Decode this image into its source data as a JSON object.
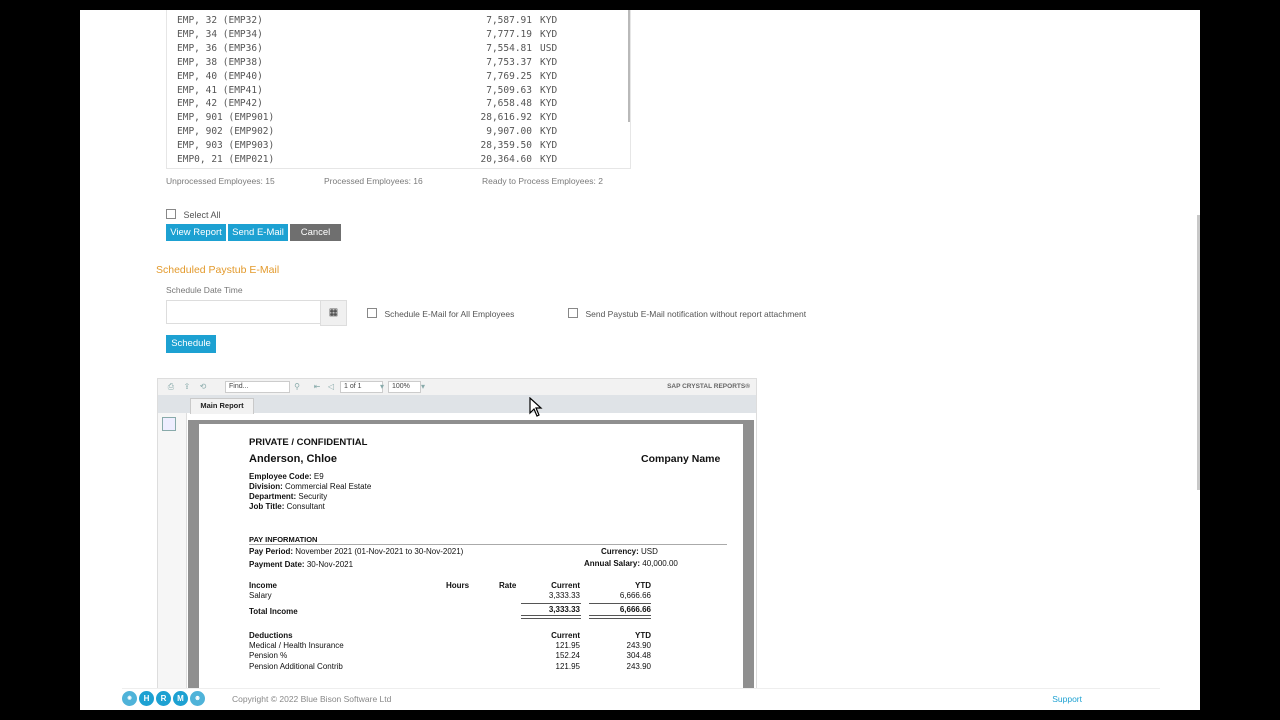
{
  "employees": [
    {
      "name": "EMP, 32 (EMP32)",
      "amount": "7,587.91",
      "currency": "KYD"
    },
    {
      "name": "EMP, 34 (EMP34)",
      "amount": "7,777.19",
      "currency": "KYD"
    },
    {
      "name": "EMP, 36 (EMP36)",
      "amount": "7,554.81",
      "currency": "USD"
    },
    {
      "name": "EMP, 38 (EMP38)",
      "amount": "7,753.37",
      "currency": "KYD"
    },
    {
      "name": "EMP, 40 (EMP40)",
      "amount": "7,769.25",
      "currency": "KYD"
    },
    {
      "name": "EMP, 41 (EMP41)",
      "amount": "7,509.63",
      "currency": "KYD"
    },
    {
      "name": "EMP, 42 (EMP42)",
      "amount": "7,658.48",
      "currency": "KYD"
    },
    {
      "name": "EMP, 901 (EMP901)",
      "amount": "28,616.92",
      "currency": "KYD"
    },
    {
      "name": "EMP, 902 (EMP902)",
      "amount": "9,907.00",
      "currency": "KYD"
    },
    {
      "name": "EMP, 903 (EMP903)",
      "amount": "28,359.50",
      "currency": "KYD"
    },
    {
      "name": "EMP0, 21 (EMP021)",
      "amount": "20,364.60",
      "currency": "KYD"
    }
  ],
  "counts": {
    "unprocessed": "Unprocessed Employees: 15",
    "processed": "Processed Employees: 16",
    "ready": "Ready to Process Employees: 2"
  },
  "select_all": "Select All",
  "buttons": {
    "view_report": "View Report",
    "send_email": "Send E-Mail",
    "cancel": "Cancel",
    "schedule": "Schedule"
  },
  "scheduled": {
    "title": "Scheduled Paystub E-Mail",
    "date_label": "Schedule Date Time",
    "date_value": "",
    "all_employees": "Schedule E-Mail for All Employees",
    "no_attachment": "Send Paystub E-Mail notification without report attachment"
  },
  "viewer": {
    "find_placeholder": "Find...",
    "page": "1 of 1",
    "zoom": "100%",
    "brand": "SAP CRYSTAL REPORTS®",
    "tab": "Main Report"
  },
  "report": {
    "confidential": "PRIVATE / CONFIDENTIAL",
    "employee_name": "Anderson, Chloe",
    "company": "Company Name",
    "employee_code_label": "Employee Code:",
    "employee_code": "E9",
    "division_label": "Division:",
    "division": "Commercial Real Estate",
    "department_label": "Department:",
    "department": "Security",
    "job_title_label": "Job Title:",
    "job_title": "Consultant",
    "pay_info": "PAY INFORMATION",
    "pay_period_label": "Pay Period:",
    "pay_period": "November 2021 (01-Nov-2021 to 30-Nov-2021)",
    "currency_label": "Currency:",
    "currency": "USD",
    "payment_date_label": "Payment Date:",
    "payment_date": "30-Nov-2021",
    "annual_salary_label": "Annual Salary:",
    "annual_salary": "40,000.00",
    "income_header": {
      "income": "Income",
      "hours": "Hours",
      "rate": "Rate",
      "current": "Current",
      "ytd": "YTD"
    },
    "income_row": {
      "label": "Salary",
      "current": "3,333.33",
      "ytd": "6,666.66"
    },
    "total_income": {
      "label": "Total Income",
      "current": "3,333.33",
      "ytd": "6,666.66"
    },
    "deductions_header": {
      "label": "Deductions",
      "current": "Current",
      "ytd": "YTD"
    },
    "deductions": [
      {
        "label": "Medical / Health Insurance",
        "current": "121.95",
        "ytd": "243.90"
      },
      {
        "label": "Pension %",
        "current": "152.24",
        "ytd": "304.48"
      },
      {
        "label": "Pension Additional Contrib",
        "current": "121.95",
        "ytd": "243.90"
      }
    ]
  },
  "footer": {
    "logo_letters": [
      "H",
      "R",
      "M"
    ],
    "copyright": "Copyright © 2022 Blue Bison Software Ltd",
    "support": "Support"
  },
  "colors": {
    "accent": "#1da1d2",
    "section_title": "#e39a2c",
    "cancel": "#6f6f6f"
  }
}
